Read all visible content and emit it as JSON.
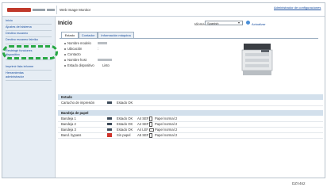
{
  "header": {
    "subtitle": "Web Image Monitor",
    "logout": "Administrador de configuraciones"
  },
  "sidebar": {
    "items": [
      {
        "label": "Inicio"
      },
      {
        "label": "Ajustes del sistema"
      },
      {
        "label": "Destino escaneo"
      },
      {
        "label": "Destino escaneo fabrika"
      },
      {
        "label": "Restringir funciones"
      },
      {
        "label": "dispositivo"
      },
      {
        "label": "Imprimir lista informe"
      },
      {
        "label": "Herramientas"
      },
      {
        "label": "administrador"
      }
    ]
  },
  "main": {
    "title": "Inicio",
    "lang_label": "Idioma",
    "lang_value": "Spanish",
    "refresh": "Actualizar",
    "tabs": [
      {
        "label": "Estado"
      },
      {
        "label": "Contador"
      },
      {
        "label": "Información máquina"
      }
    ],
    "props": [
      {
        "label": "Nombre modelo",
        "value": ""
      },
      {
        "label": "Ubicación",
        "value": ":"
      },
      {
        "label": "Contacto",
        "value": ""
      },
      {
        "label": "Nombre host",
        "value": ""
      },
      {
        "label": "Estado dispositivo",
        "value": "Listo"
      }
    ],
    "estado": {
      "header": "Estado",
      "rows": [
        {
          "name": "Cartucho de impresión",
          "status": "Estado OK"
        }
      ]
    },
    "bandeja": {
      "header": "Bandeja de papel",
      "rows": [
        {
          "name": "Bandeja 1",
          "status": "Estado OK",
          "size": "A4 SEF",
          "paper": "Papel normal 2",
          "error": false
        },
        {
          "name": "Bandeja 2",
          "status": "Estado OK",
          "size": "A4 SEF",
          "paper": "Papel normal 2",
          "error": false
        },
        {
          "name": "Bandeja 3",
          "status": "Estado OK",
          "size": "A4 LEF",
          "paper": "Papel normal 2",
          "error": false
        },
        {
          "name": "Band. bypass",
          "status": "Sin papel",
          "size": "A5 SEF",
          "paper": "Papel normal 2",
          "error": true
        }
      ]
    }
  },
  "figure_code": "DZV462",
  "colors": {
    "accent": "#1a4fa0",
    "section": "#d3e0ec",
    "callout": "#27a844",
    "error": "#d0342c"
  }
}
